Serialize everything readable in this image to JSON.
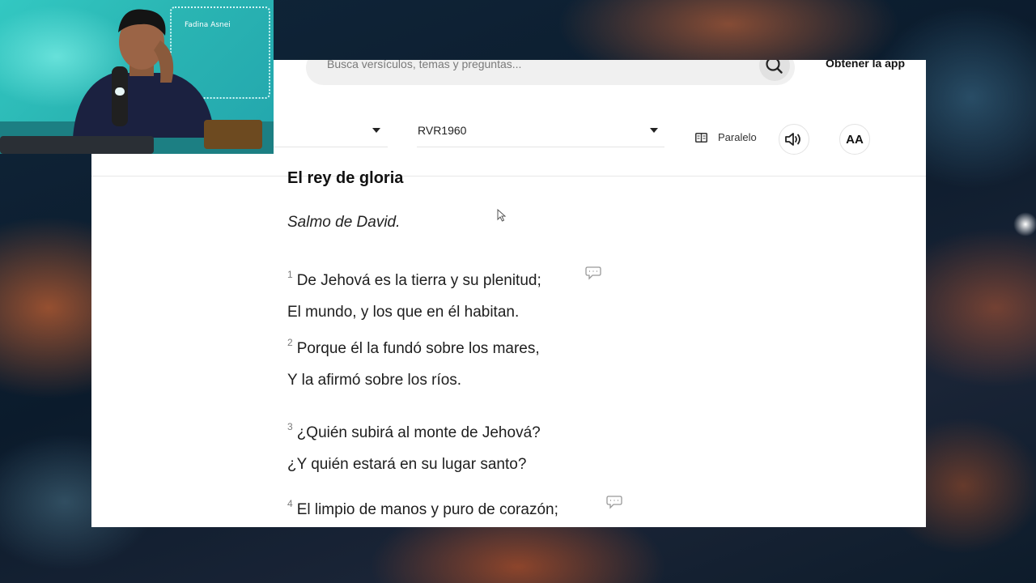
{
  "header": {
    "search_placeholder": "Busca versículos, temas y preguntas...",
    "get_app_label": "Obtener la app"
  },
  "toolbar": {
    "book_selector_value": "",
    "version_selector_value": "RVR1960",
    "parallel_label": "Paralelo",
    "font_button_label": "AA"
  },
  "reading": {
    "section_title": "El rey de gloria",
    "superscription": "Salmo de David.",
    "lines": [
      {
        "verse": "1",
        "text": "De Jehová es la tierra y su plenitud;"
      },
      {
        "verse": "",
        "text": "El mundo, y los que en él habitan."
      },
      {
        "verse": "2",
        "text": "Porque él la fundó sobre los mares,"
      },
      {
        "verse": "",
        "text": "Y la afirmó sobre los ríos."
      },
      {
        "verse": "3",
        "text": "¿Quién subirá al monte de Jehová?"
      },
      {
        "verse": "",
        "text": "¿Y quién estará en su lugar santo?"
      },
      {
        "verse": "4",
        "text": "El limpio de manos y puro de corazón;"
      }
    ]
  },
  "webcam": {
    "neon_sign": "Fadina Asnei"
  },
  "icons": {
    "search": "search-icon",
    "dropdown": "chevron-down-icon",
    "parallel": "book-columns-icon",
    "audio": "speaker-icon",
    "note": "comment-icon",
    "cursor": "mouse-pointer-icon"
  }
}
